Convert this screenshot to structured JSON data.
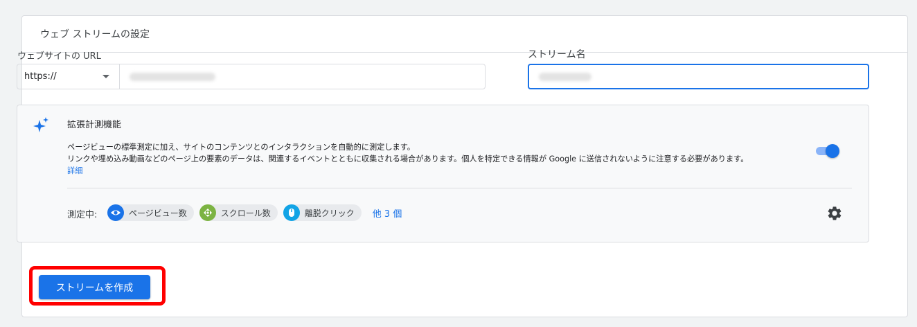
{
  "card": {
    "title": "ウェブ ストリームの設定"
  },
  "url_field": {
    "label": "ウェブサイトの URL",
    "protocol": "https://"
  },
  "name_field": {
    "label": "ストリーム名"
  },
  "enhanced": {
    "title": "拡張計測機能",
    "desc_line1": "ページビューの標準測定に加え、サイトのコンテンツとのインタラクションを自動的に測定します。",
    "desc_line2": "リンクや埋め込み動画などのページ上の要素のデータは、関連するイベントとともに収集される場合があります。個人を特定できる情報が Google に送信されないように注意する必要があります。",
    "more_link": "詳細",
    "toggle_on": true,
    "measuring_label": "測定中:",
    "chips": [
      {
        "label": "ページビュー数",
        "icon": "eye-icon",
        "color": "#1a73e8"
      },
      {
        "label": "スクロール数",
        "icon": "scroll-icon",
        "color": "#7cb342"
      },
      {
        "label": "離脱クリック",
        "icon": "mouse-icon",
        "color": "#12a4e6"
      }
    ],
    "others_link": "他 3 個"
  },
  "create_button": {
    "label": "ストリームを作成"
  },
  "colors": {
    "accent": "#1a73e8",
    "highlight": "#ff0000"
  }
}
